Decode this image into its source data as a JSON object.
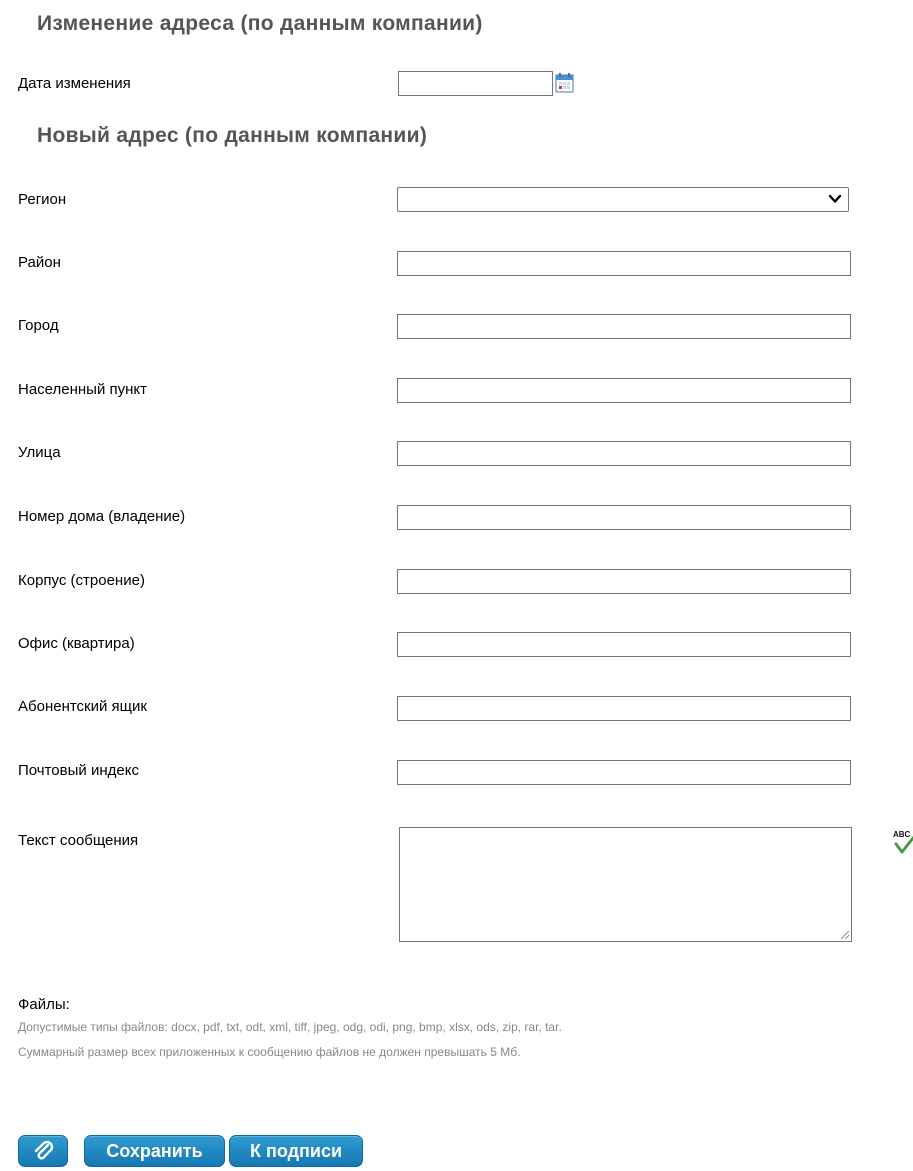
{
  "sections": {
    "change_title": "Изменение адреса (по данным компании)",
    "new_address_title": "Новый адрес (по данным компании)"
  },
  "date_field": {
    "label": "Дата изменения",
    "value": "",
    "icon": "calendar-icon"
  },
  "fields": {
    "region": {
      "label": "Регион",
      "value": ""
    },
    "district": {
      "label": "Район",
      "value": ""
    },
    "city": {
      "label": "Город",
      "value": ""
    },
    "locality": {
      "label": "Населенный пункт",
      "value": ""
    },
    "street": {
      "label": "Улица",
      "value": ""
    },
    "house": {
      "label": "Номер дома (владение)",
      "value": ""
    },
    "building": {
      "label": "Корпус (строение)",
      "value": ""
    },
    "office": {
      "label": "Офис (квартира)",
      "value": ""
    },
    "po_box": {
      "label": "Абонентский ящик",
      "value": ""
    },
    "postal_code": {
      "label": "Почтовый индекс",
      "value": ""
    },
    "message": {
      "label": "Текст сообщения",
      "value": ""
    }
  },
  "files": {
    "title": "Файлы:",
    "allowed_types": "Допустимые типы файлов: docx, pdf, txt, odt, xml, tiff, jpeg, odg, odi, png, bmp, xlsx, ods, zip, rar, tar.",
    "size_limit": "Суммарный размер всех приложенных к сообщению файлов не должен превышать 5 Мб."
  },
  "buttons": {
    "attach_icon": "paperclip-icon",
    "save": "Сохранить",
    "sign": "К подписи"
  },
  "colors": {
    "button": "#1a83bf",
    "section_title": "#555555",
    "hint_text": "#888888"
  }
}
